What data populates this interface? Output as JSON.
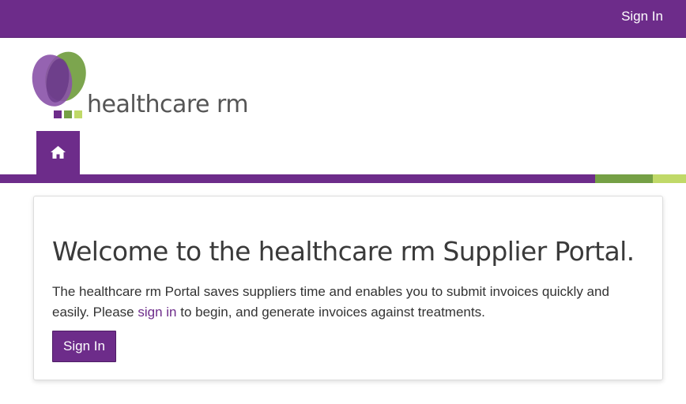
{
  "header": {
    "signin_label": "Sign In"
  },
  "brand": {
    "wordmark": "healthcare rm",
    "colors": {
      "purple": "#6d2c8a",
      "green": "#75a045",
      "lime": "#c0d968"
    }
  },
  "nav": {
    "home_icon": "home-icon"
  },
  "welcome": {
    "title": "Welcome to the healthcare rm Supplier Portal.",
    "intro_before": "The healthcare rm Portal saves suppliers time and enables you to submit invoices quickly and easily. Please ",
    "intro_link": "sign in",
    "intro_after": " to begin, and generate invoices against treatments.",
    "button_label": "Sign In"
  }
}
